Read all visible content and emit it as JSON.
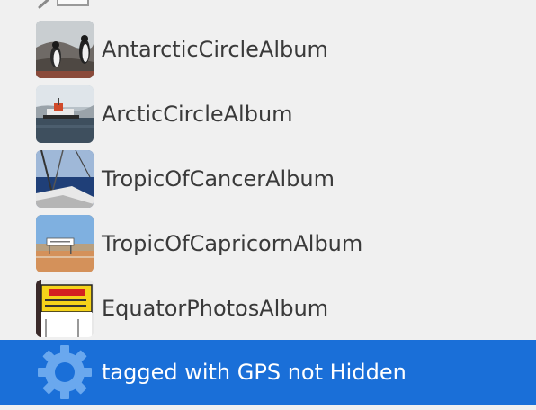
{
  "albums": [
    {
      "label": "AntarcticCircleAlbum",
      "icon": "penguin-photo-thumbnail"
    },
    {
      "label": "ArcticCircleAlbum",
      "icon": "ship-photo-thumbnail"
    },
    {
      "label": "TropicOfCancerAlbum",
      "icon": "sailboat-photo-thumbnail"
    },
    {
      "label": "TropicOfCapricornAlbum",
      "icon": "road-sign-photo-thumbnail"
    },
    {
      "label": "EquatorPhotosAlbum",
      "icon": "ecuador-sign-photo-thumbnail"
    }
  ],
  "smart_album": {
    "label": "tagged with GPS not Hidden",
    "icon": "gear-icon",
    "selected": true
  },
  "colors": {
    "background": "#f0f0f0",
    "selection": "#1a6fd8",
    "text": "#3a3a3a",
    "selected_text": "#ffffff",
    "gear": "#6aa8ee"
  }
}
